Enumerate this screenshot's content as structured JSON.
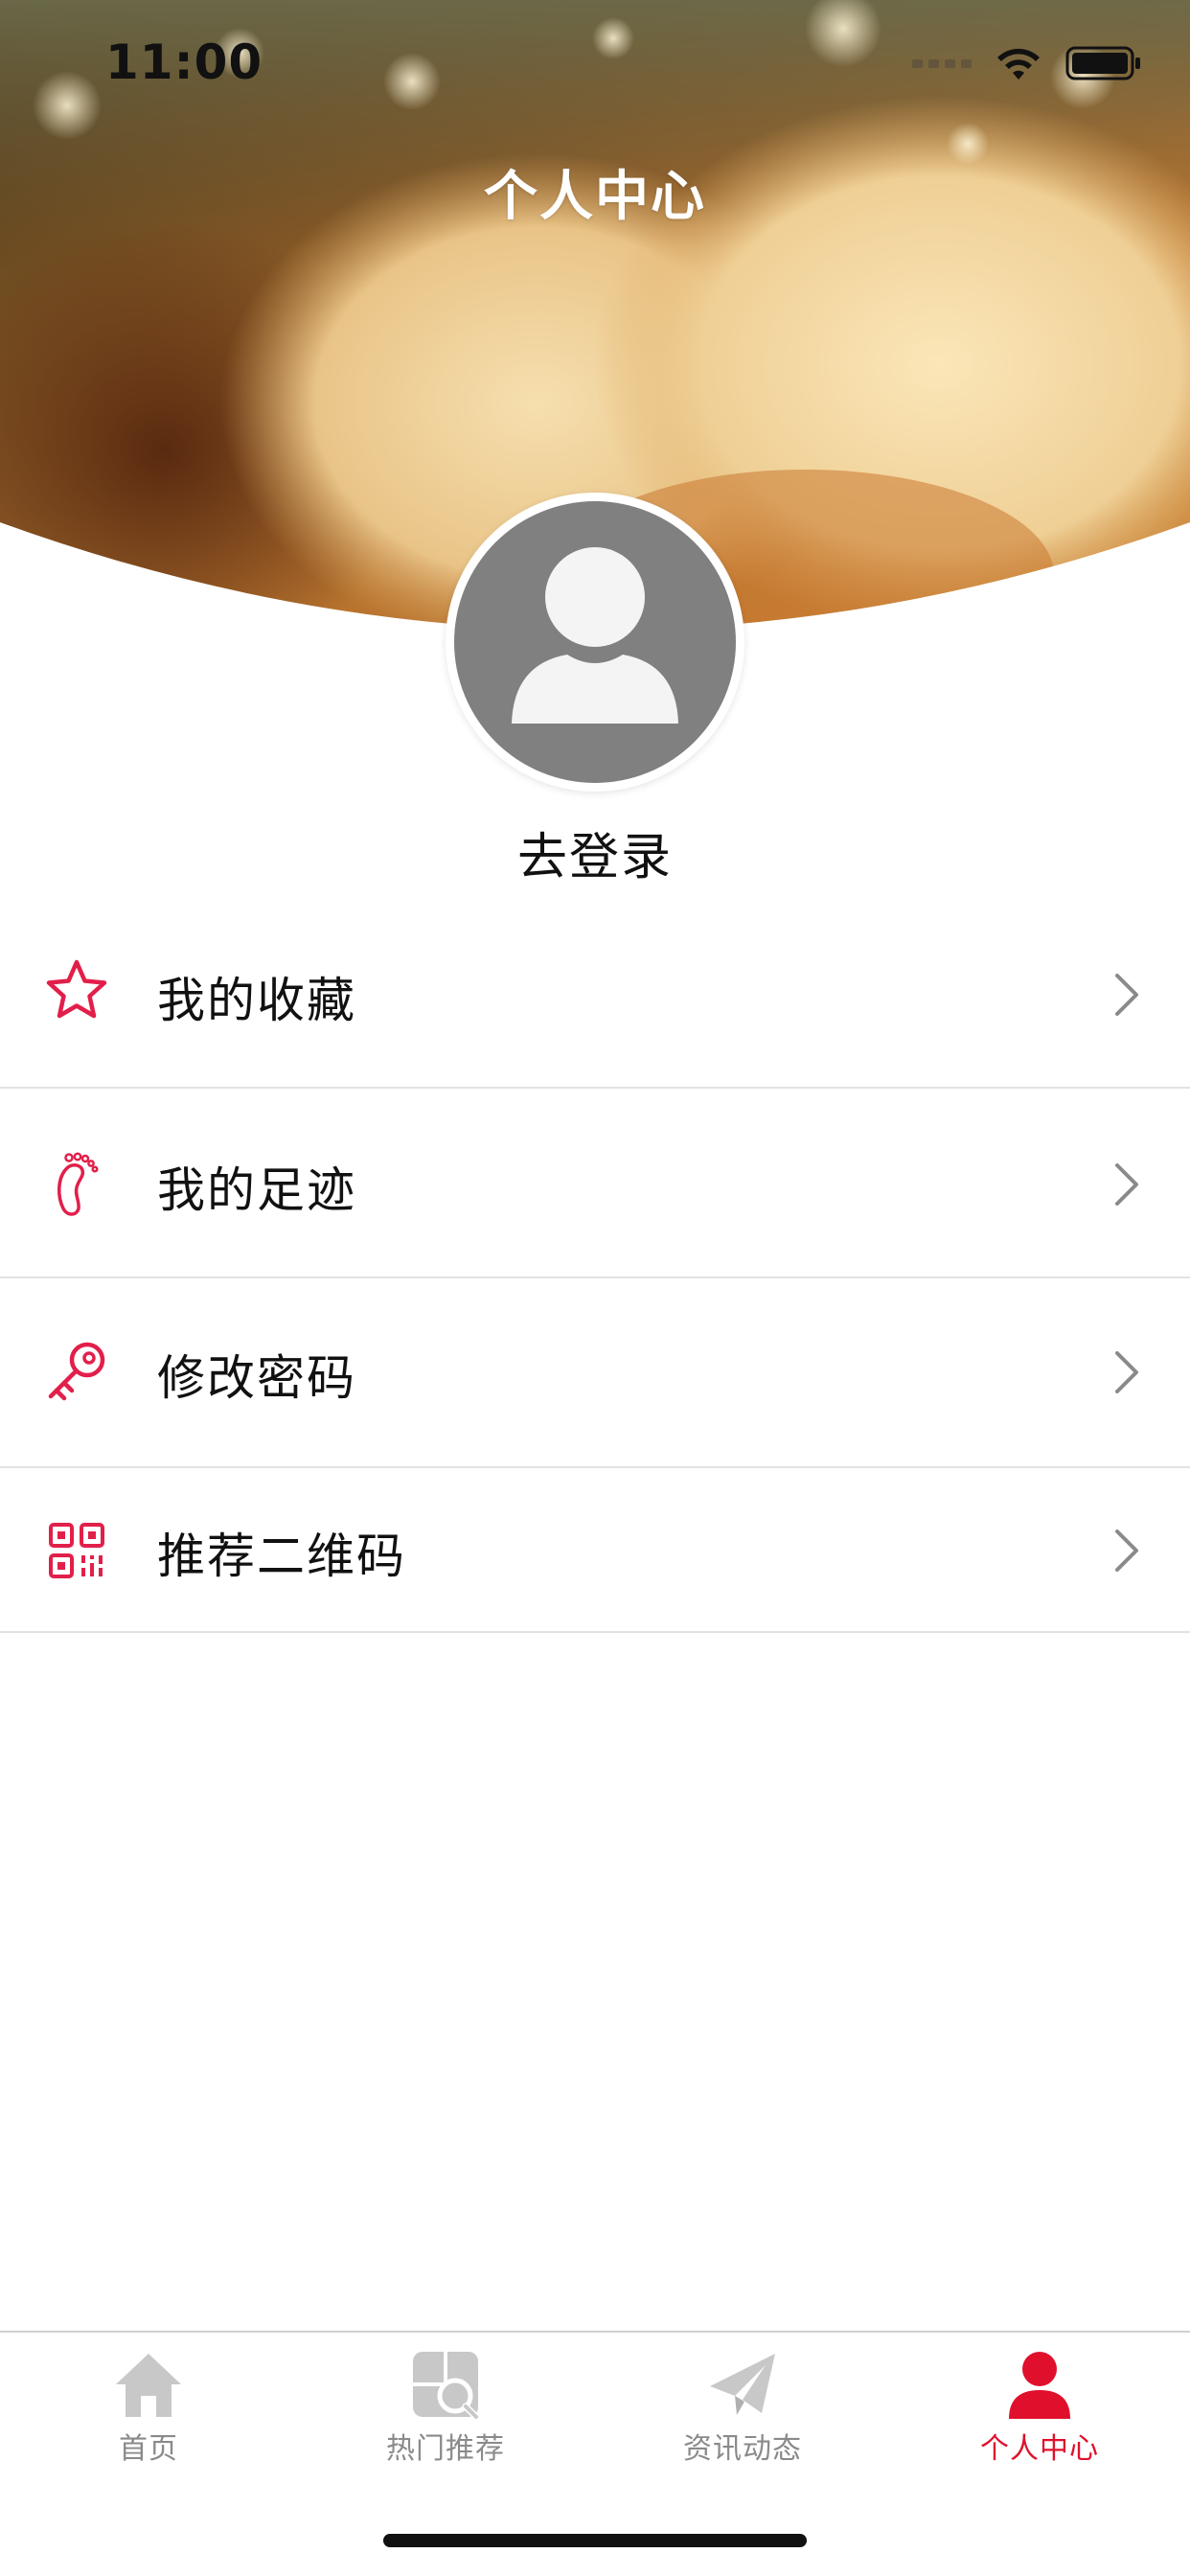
{
  "status_bar": {
    "time": "11:00"
  },
  "header": {
    "title": "个人中心"
  },
  "profile": {
    "login_label": "去登录"
  },
  "menu": {
    "items": [
      {
        "label": "我的收藏",
        "icon": "star-icon"
      },
      {
        "label": "我的足迹",
        "icon": "footprint-icon"
      },
      {
        "label": "修改密码",
        "icon": "key-icon"
      },
      {
        "label": "推荐二维码",
        "icon": "qrcode-icon"
      }
    ]
  },
  "tabbar": {
    "items": [
      {
        "label": "首页",
        "icon": "home-icon",
        "active": false
      },
      {
        "label": "热门推荐",
        "icon": "hot-search-icon",
        "active": false
      },
      {
        "label": "资讯动态",
        "icon": "paper-plane-icon",
        "active": false
      },
      {
        "label": "个人中心",
        "icon": "person-icon",
        "active": true
      }
    ]
  },
  "colors": {
    "accent": "#e0102c",
    "icon_red": "#e21f4a",
    "inactive_tab": "#8a8a8a",
    "avatar_gray": "#808080",
    "divider": "#e2e2e2"
  }
}
